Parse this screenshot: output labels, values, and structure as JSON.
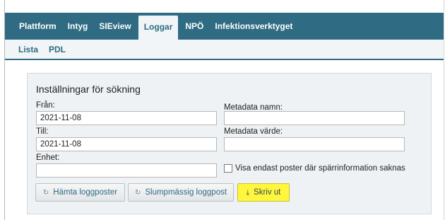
{
  "topnav": {
    "tabs": [
      {
        "label": "Plattform"
      },
      {
        "label": "Intyg"
      },
      {
        "label": "SIEview"
      },
      {
        "label": "Loggar"
      },
      {
        "label": "NPÖ"
      },
      {
        "label": "Infektionsverktyget"
      }
    ],
    "active_tab": "Loggar"
  },
  "subnav": {
    "items": [
      {
        "label": "Lista"
      },
      {
        "label": "PDL"
      }
    ]
  },
  "panel": {
    "title": "Inställningar för sökning",
    "fran": {
      "label": "Från:",
      "value": "2021-11-08"
    },
    "till": {
      "label": "Till:",
      "value": "2021-11-08"
    },
    "enhet": {
      "label": "Enhet:",
      "value": ""
    },
    "metadata_namn": {
      "label": "Metadata namn:",
      "value": ""
    },
    "metadata_varde": {
      "label": "Metadata värde:",
      "value": ""
    },
    "checkbox_label": "Visa endast poster där spärrinformation saknas"
  },
  "buttons": {
    "fetch": {
      "label": "Hämta loggposter",
      "icon": "refresh-icon"
    },
    "random": {
      "label": "Slumpmässig loggpost",
      "icon": "refresh-icon"
    },
    "print": {
      "label": "Skriv ut",
      "icon": "download-icon"
    }
  },
  "colors": {
    "nav_bg": "#2f6b82",
    "subnav_bg": "#f2f5f7",
    "panel_bg": "#eef2f4",
    "highlight": "#fff63d"
  }
}
